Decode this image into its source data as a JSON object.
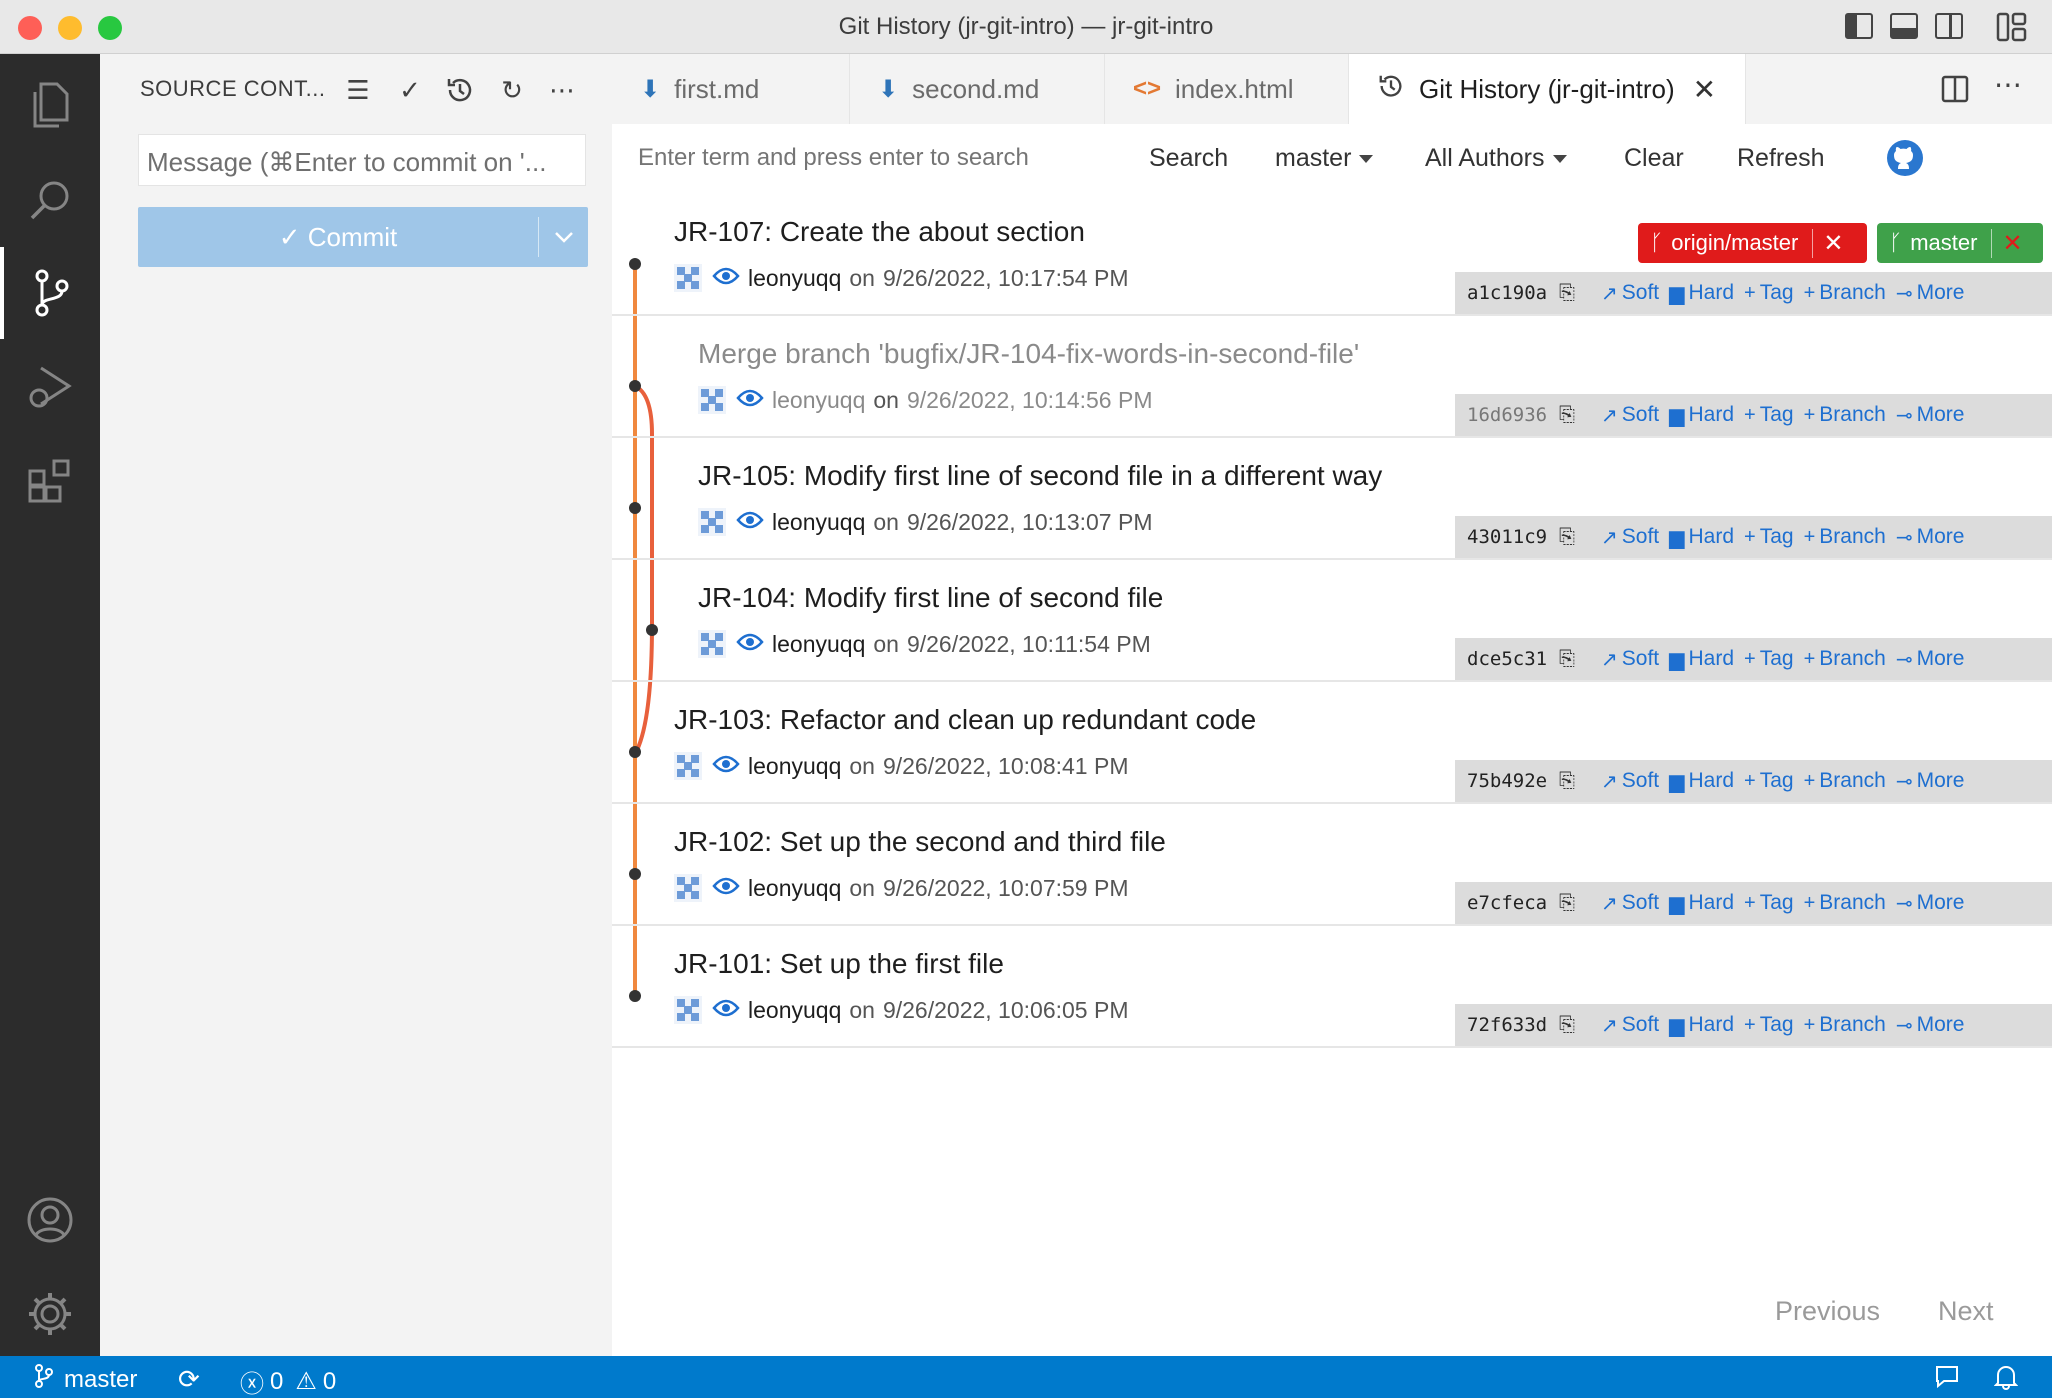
{
  "window": {
    "title": "Git History (jr-git-intro) — jr-git-intro"
  },
  "sidebar": {
    "title": "SOURCE CONT...",
    "commit_placeholder": "Message (⌘Enter to commit on '...",
    "commit_label": "Commit"
  },
  "tabs": [
    {
      "label": "first.md",
      "icon": "markdown-down-arrow-icon"
    },
    {
      "label": "second.md",
      "icon": "markdown-down-arrow-icon"
    },
    {
      "label": "index.html",
      "icon": "html-code-icon"
    },
    {
      "label": "Git History (jr-git-intro)",
      "icon": "history-icon"
    }
  ],
  "toolbar": {
    "search_placeholder": "Enter term and press enter to search",
    "search": "Search",
    "branch": "master",
    "authors": "All Authors",
    "clear": "Clear",
    "refresh": "Refresh"
  },
  "actions": {
    "soft": "Soft",
    "hard": "Hard",
    "tag": "Tag",
    "branch": "Branch",
    "more": "More"
  },
  "refs": {
    "origin": "origin/master",
    "local": "master"
  },
  "commits": [
    {
      "message": "JR-107: Create the about section",
      "author": "leonyuqq",
      "on": "on",
      "date": "9/26/2022, 10:17:54 PM",
      "hash": "a1c190a"
    },
    {
      "message": "Merge branch 'bugfix/JR-104-fix-words-in-second-file'",
      "author": "leonyuqq",
      "on": "on",
      "date": "9/26/2022, 10:14:56 PM",
      "hash": "16d6936"
    },
    {
      "message": "JR-105: Modify first line of second file in a different way",
      "author": "leonyuqq",
      "on": "on",
      "date": "9/26/2022, 10:13:07 PM",
      "hash": "43011c9"
    },
    {
      "message": "JR-104: Modify first line of second file",
      "author": "leonyuqq",
      "on": "on",
      "date": "9/26/2022, 10:11:54 PM",
      "hash": "dce5c31"
    },
    {
      "message": "JR-103: Refactor and clean up redundant code",
      "author": "leonyuqq",
      "on": "on",
      "date": "9/26/2022, 10:08:41 PM",
      "hash": "75b492e"
    },
    {
      "message": "JR-102: Set up the second and third file",
      "author": "leonyuqq",
      "on": "on",
      "date": "9/26/2022, 10:07:59 PM",
      "hash": "e7cfeca"
    },
    {
      "message": "JR-101: Set up the first file",
      "author": "leonyuqq",
      "on": "on",
      "date": "9/26/2022, 10:06:05 PM",
      "hash": "72f633d"
    }
  ],
  "pager": {
    "previous": "Previous",
    "next": "Next"
  },
  "statusbar": {
    "branch": "master",
    "errors": "0",
    "warnings": "0"
  },
  "colors": {
    "graph_main": "#f0883e",
    "graph_branch": "#e8603c",
    "origin_badge": "#e01b1b",
    "local_badge": "#3fa14a",
    "link": "#1e6fd0",
    "statusbar": "#007acc"
  }
}
